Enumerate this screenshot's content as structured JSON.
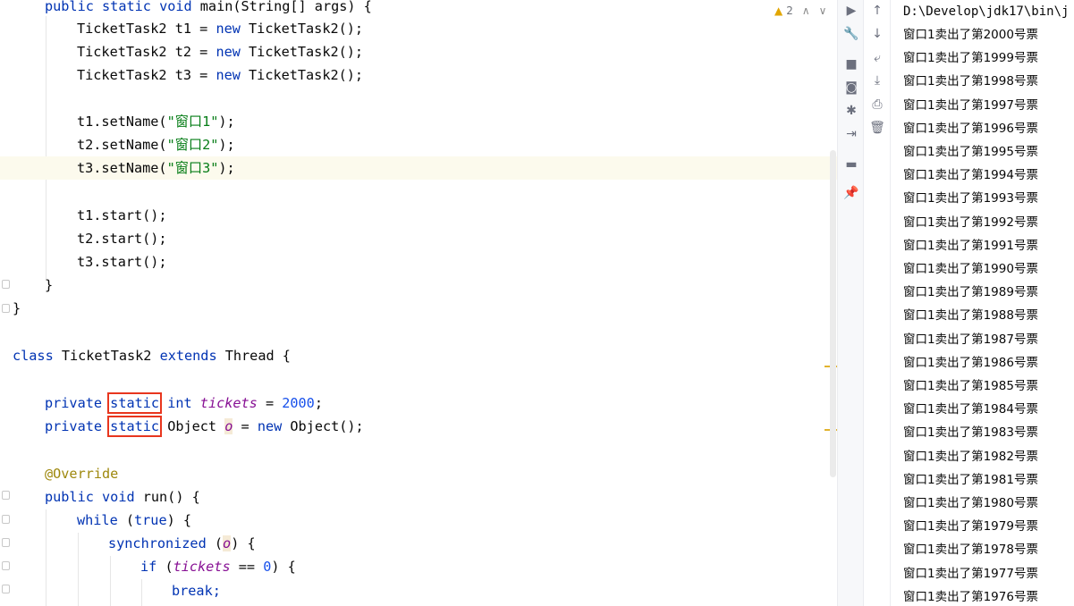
{
  "editor": {
    "inspection": {
      "warning_count": "2",
      "prev": "∧",
      "next": "∨"
    },
    "code": {
      "main_sig": {
        "kw1": "public",
        "kw2": "static",
        "kw3": "void",
        "rest": " main(String[] args) {"
      },
      "t1_decl": {
        "type": "TicketTask2 t1 = ",
        "kw": "new",
        "ctor": " TicketTask2();"
      },
      "t2_decl": {
        "type": "TicketTask2 t2 = ",
        "kw": "new",
        "ctor": " TicketTask2();"
      },
      "t3_decl": {
        "type": "TicketTask2 t3 = ",
        "kw": "new",
        "ctor": " TicketTask2();"
      },
      "t1_setname": {
        "call": "t1.setName(",
        "arg": "\"窗口1\"",
        "end": ");"
      },
      "t2_setname": {
        "call": "t2.setName(",
        "arg": "\"窗口2\"",
        "end": ");"
      },
      "t3_setname": {
        "call": "t3.setName(",
        "arg": "\"窗口3\"",
        "end": ");"
      },
      "t1_start": "t1.start();",
      "t2_start": "t2.start();",
      "t3_start": "t3.start();",
      "close_main": "}",
      "close_class": "}",
      "class_decl": {
        "kw1": "class",
        "name": " TicketTask2 ",
        "kw2": "extends",
        "rest": " Thread {"
      },
      "tickets_field": {
        "kw1": "private",
        "kw2": "static",
        "kw3": "int",
        "name": "tickets",
        "eq": " = ",
        "value": "2000",
        "end": ";"
      },
      "lock_field": {
        "kw1": "private",
        "kw2": "static",
        "type": "Object ",
        "name": "o",
        "eq": " = ",
        "kw3": "new",
        "end": " Object();"
      },
      "annotation": "@Override",
      "run_sig": {
        "kw1": "public",
        "kw2": "void",
        "rest": " run() {"
      },
      "while_line": {
        "kw": "while",
        "open": " (",
        "cond": "true",
        "close": ") {"
      },
      "sync_line": {
        "kw": "synchronized",
        "open": " (",
        "var": "o",
        "close": ") {"
      },
      "if_line": {
        "kw": "if",
        "open": " (",
        "var": "tickets",
        "op": " == ",
        "num": "0",
        "close": ") {"
      },
      "break_line": "break;"
    }
  },
  "run_toolbar": {
    "icons": [
      "run-icon",
      "wrench-icon",
      "stop-icon",
      "camera-icon",
      "bug-settings-icon",
      "exit-icon",
      "layout-icon",
      "pin-icon"
    ]
  },
  "console_toolbar": {
    "icons": [
      "arrow-up-icon",
      "arrow-down-icon",
      "soft-wrap-icon",
      "scroll-to-end-icon",
      "print-icon",
      "trash-icon"
    ]
  },
  "console": {
    "path": "D:\\Develop\\jdk17\\bin\\j",
    "lines": [
      "窗口1卖出了第2000号票",
      "窗口1卖出了第1999号票",
      "窗口1卖出了第1998号票",
      "窗口1卖出了第1997号票",
      "窗口1卖出了第1996号票",
      "窗口1卖出了第1995号票",
      "窗口1卖出了第1994号票",
      "窗口1卖出了第1993号票",
      "窗口1卖出了第1992号票",
      "窗口1卖出了第1991号票",
      "窗口1卖出了第1990号票",
      "窗口1卖出了第1989号票",
      "窗口1卖出了第1988号票",
      "窗口1卖出了第1987号票",
      "窗口1卖出了第1986号票",
      "窗口1卖出了第1985号票",
      "窗口1卖出了第1984号票",
      "窗口1卖出了第1983号票",
      "窗口1卖出了第1982号票",
      "窗口1卖出了第1981号票",
      "窗口1卖出了第1980号票",
      "窗口1卖出了第1979号票",
      "窗口1卖出了第1978号票",
      "窗口1卖出了第1977号票",
      "窗口1卖出了第1976号票"
    ]
  },
  "colors": {
    "keyword": "#0033b3",
    "string": "#067d17",
    "number": "#1750eb",
    "field": "#871094",
    "annotation": "#9e880d",
    "highlight_box": "#e8361e",
    "current_line": "#fcfaed"
  }
}
